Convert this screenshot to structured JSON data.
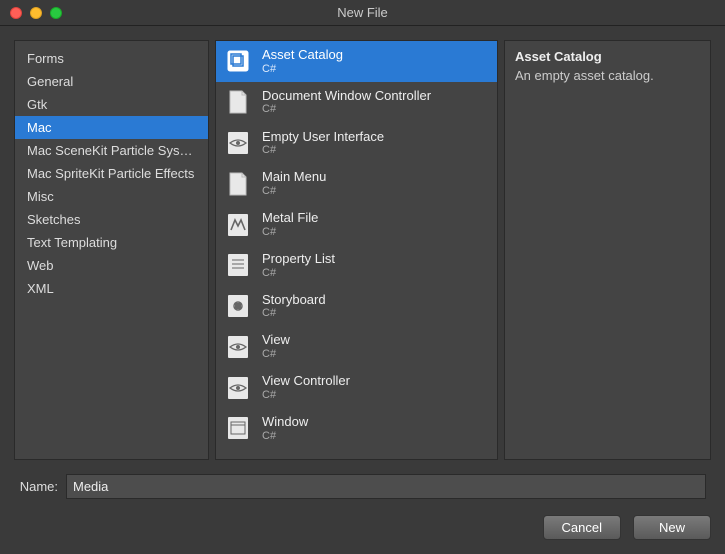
{
  "window": {
    "title": "New File"
  },
  "categories": [
    {
      "label": "Forms"
    },
    {
      "label": "General"
    },
    {
      "label": "Gtk"
    },
    {
      "label": "Mac",
      "selected": true
    },
    {
      "label": "Mac SceneKit Particle Systems"
    },
    {
      "label": "Mac SpriteKit Particle Effects"
    },
    {
      "label": "Misc"
    },
    {
      "label": "Sketches"
    },
    {
      "label": "Text Templating"
    },
    {
      "label": "Web"
    },
    {
      "label": "XML"
    }
  ],
  "templates": [
    {
      "name": "Asset Catalog",
      "sub": "C#",
      "icon": "asset-catalog",
      "selected": true
    },
    {
      "name": "Document Window Controller",
      "sub": "C#",
      "icon": "doc"
    },
    {
      "name": "Empty User Interface",
      "sub": "C#",
      "icon": "eye"
    },
    {
      "name": "Main Menu",
      "sub": "C#",
      "icon": "doc"
    },
    {
      "name": "Metal File",
      "sub": "C#",
      "icon": "metal"
    },
    {
      "name": "Property List",
      "sub": "C#",
      "icon": "plist"
    },
    {
      "name": "Storyboard",
      "sub": "C#",
      "icon": "storyboard"
    },
    {
      "name": "View",
      "sub": "C#",
      "icon": "eye"
    },
    {
      "name": "View Controller",
      "sub": "C#",
      "icon": "eye"
    },
    {
      "name": "Window",
      "sub": "C#",
      "icon": "window"
    }
  ],
  "detail": {
    "title": "Asset Catalog",
    "description": "An empty asset catalog."
  },
  "name_field": {
    "label": "Name:",
    "value": "Media"
  },
  "buttons": {
    "cancel": "Cancel",
    "create": "New"
  }
}
